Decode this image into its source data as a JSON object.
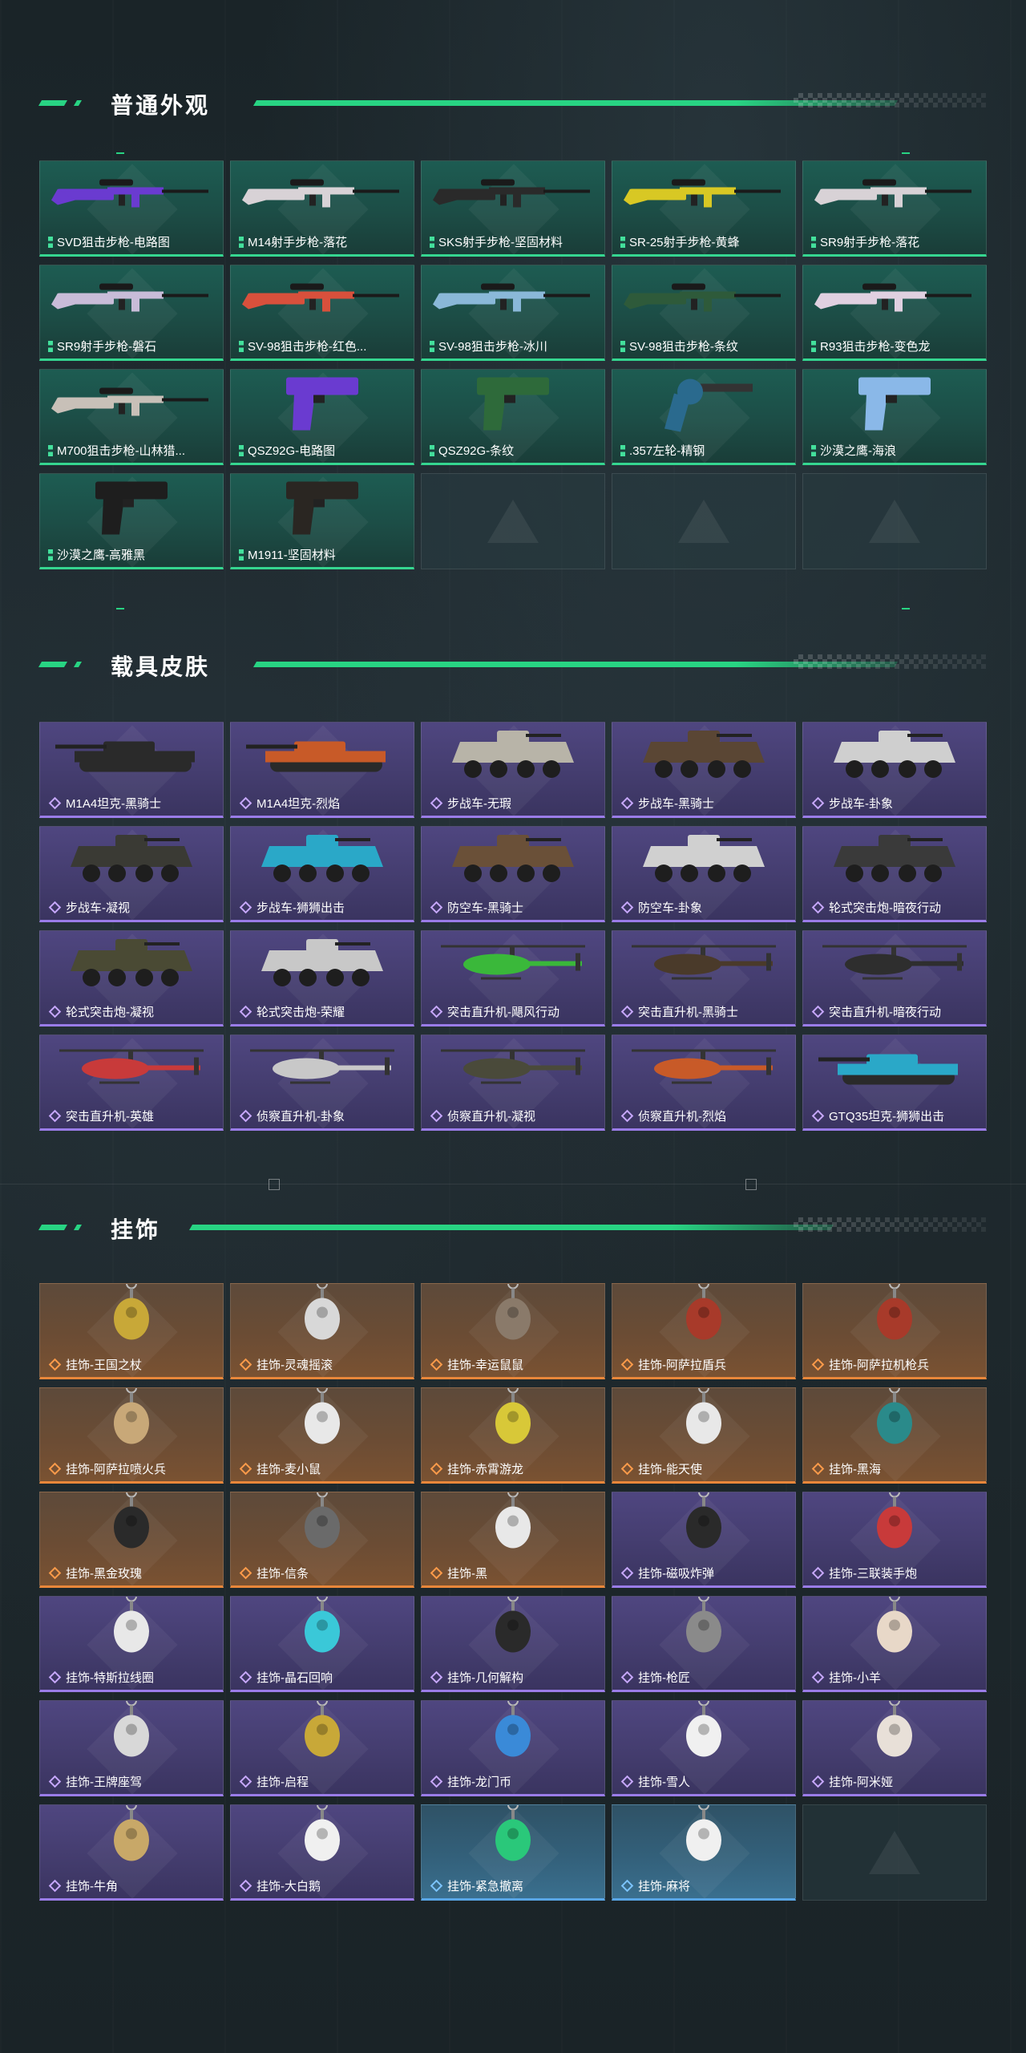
{
  "sections": [
    {
      "title": "普通外观",
      "items": [
        {
          "label": "SVD狙击步枪-电路图",
          "rarity": "green",
          "icon": "rifle-icon",
          "color": "#6a3bd0"
        },
        {
          "label": "M14射手步枪-落花",
          "rarity": "green",
          "icon": "rifle-icon",
          "color": "#d8d2d6"
        },
        {
          "label": "SKS射手步枪-坚固材料",
          "rarity": "green",
          "icon": "rifle-icon",
          "color": "#2a2a2a"
        },
        {
          "label": "SR-25射手步枪-黄蜂",
          "rarity": "green",
          "icon": "rifle-icon",
          "color": "#d8c824"
        },
        {
          "label": "SR9射手步枪-落花",
          "rarity": "green",
          "icon": "rifle-icon",
          "color": "#d8d2d6"
        },
        {
          "label": "SR9射手步枪-磐石",
          "rarity": "green",
          "icon": "rifle-icon",
          "color": "#c8bcd8"
        },
        {
          "label": "SV-98狙击步枪-红色...",
          "rarity": "green",
          "icon": "rifle-icon",
          "color": "#d8503c"
        },
        {
          "label": "SV-98狙击步枪-冰川",
          "rarity": "green",
          "icon": "rifle-icon",
          "color": "#8ab8d8"
        },
        {
          "label": "SV-98狙击步枪-条纹",
          "rarity": "green",
          "icon": "rifle-icon",
          "color": "#2e5a3a"
        },
        {
          "label": "R93狙击步枪-变色龙",
          "rarity": "green",
          "icon": "rifle-icon",
          "color": "#e0d0e0"
        },
        {
          "label": "M700狙击步枪-山林猎...",
          "rarity": "green",
          "icon": "rifle-icon",
          "color": "#c8c0b8"
        },
        {
          "label": "QSZ92G-电路图",
          "rarity": "green",
          "icon": "pistol-icon",
          "color": "#6a3bd0"
        },
        {
          "label": "QSZ92G-条纹",
          "rarity": "green",
          "icon": "pistol-icon",
          "color": "#2e6a3a"
        },
        {
          "label": ".357左轮-精钢",
          "rarity": "green",
          "icon": "revolver-icon",
          "color": "#2a6a8e"
        },
        {
          "label": "沙漠之鹰-海浪",
          "rarity": "green",
          "icon": "pistol-icon",
          "color": "#8ab8e8"
        },
        {
          "label": "沙漠之鹰-高雅黑",
          "rarity": "green",
          "icon": "pistol-icon",
          "color": "#1e1e1e"
        },
        {
          "label": "M1911-坚固材料",
          "rarity": "green",
          "icon": "pistol-icon",
          "color": "#2a2622"
        },
        {
          "label": "",
          "rarity": "empty"
        },
        {
          "label": "",
          "rarity": "empty"
        },
        {
          "label": "",
          "rarity": "empty"
        }
      ]
    },
    {
      "title": "载具皮肤",
      "items": [
        {
          "label": "M1A4坦克-黑骑士",
          "rarity": "purple",
          "icon": "tank-icon",
          "color": "#2a2a2a"
        },
        {
          "label": "M1A4坦克-烈焰",
          "rarity": "purple",
          "icon": "tank-icon",
          "color": "#c85a28"
        },
        {
          "label": "步战车-无瑕",
          "rarity": "purple",
          "icon": "armored-vehicle-icon",
          "color": "#b8b4a8"
        },
        {
          "label": "步战车-黑骑士",
          "rarity": "purple",
          "icon": "armored-vehicle-icon",
          "color": "#5a4634"
        },
        {
          "label": "步战车-卦象",
          "rarity": "purple",
          "icon": "armored-vehicle-icon",
          "color": "#cfcfcf"
        },
        {
          "label": "步战车-凝视",
          "rarity": "purple",
          "icon": "armored-vehicle-icon",
          "color": "#3a3a34"
        },
        {
          "label": "步战车-狮狮出击",
          "rarity": "purple",
          "icon": "armored-vehicle-icon",
          "color": "#2aa8c8"
        },
        {
          "label": "防空车-黑骑士",
          "rarity": "purple",
          "icon": "armored-vehicle-icon",
          "color": "#6a5038"
        },
        {
          "label": "防空车-卦象",
          "rarity": "purple",
          "icon": "armored-vehicle-icon",
          "color": "#d0d0d0"
        },
        {
          "label": "轮式突击炮-暗夜行动",
          "rarity": "purple",
          "icon": "armored-vehicle-icon",
          "color": "#3a3a3a"
        },
        {
          "label": "轮式突击炮-凝视",
          "rarity": "purple",
          "icon": "armored-vehicle-icon",
          "color": "#4a4a34"
        },
        {
          "label": "轮式突击炮-荣耀",
          "rarity": "purple",
          "icon": "armored-vehicle-icon",
          "color": "#c8c8c8"
        },
        {
          "label": "突击直升机-飓风行动",
          "rarity": "purple",
          "icon": "helicopter-icon",
          "color": "#3ab83a"
        },
        {
          "label": "突击直升机-黑骑士",
          "rarity": "purple",
          "icon": "helicopter-icon",
          "color": "#4a3a2a"
        },
        {
          "label": "突击直升机-暗夜行动",
          "rarity": "purple",
          "icon": "helicopter-icon",
          "color": "#2e2e2e"
        },
        {
          "label": "突击直升机-英雄",
          "rarity": "purple",
          "icon": "helicopter-icon",
          "color": "#c83a3a"
        },
        {
          "label": "侦察直升机-卦象",
          "rarity": "purple",
          "icon": "helicopter-icon",
          "color": "#c8c8c8"
        },
        {
          "label": "侦察直升机-凝视",
          "rarity": "purple",
          "icon": "helicopter-icon",
          "color": "#4a4a3a"
        },
        {
          "label": "侦察直升机-烈焰",
          "rarity": "purple",
          "icon": "helicopter-icon",
          "color": "#c85a28"
        },
        {
          "label": "GTQ35坦克-狮狮出击",
          "rarity": "purple",
          "icon": "tank-icon",
          "color": "#2aa8c8"
        }
      ]
    },
    {
      "title": "挂饰",
      "items": [
        {
          "label": "挂饰-王国之杖",
          "rarity": "orange",
          "icon": "charm-icon",
          "color": "#c8a838"
        },
        {
          "label": "挂饰-灵魂摇滚",
          "rarity": "orange",
          "icon": "charm-icon",
          "color": "#d8d8d8"
        },
        {
          "label": "挂饰-幸运鼠鼠",
          "rarity": "orange",
          "icon": "charm-icon",
          "color": "#8a7a6a"
        },
        {
          "label": "挂饰-阿萨拉盾兵",
          "rarity": "orange",
          "icon": "charm-icon",
          "color": "#a83a2a"
        },
        {
          "label": "挂饰-阿萨拉机枪兵",
          "rarity": "orange",
          "icon": "charm-icon",
          "color": "#a83a2a"
        },
        {
          "label": "挂饰-阿萨拉喷火兵",
          "rarity": "orange",
          "icon": "charm-icon",
          "color": "#c8a878"
        },
        {
          "label": "挂饰-麦小鼠",
          "rarity": "orange",
          "icon": "charm-icon",
          "color": "#e8e8e8"
        },
        {
          "label": "挂饰-赤霄游龙",
          "rarity": "orange",
          "icon": "charm-icon",
          "color": "#d8c838"
        },
        {
          "label": "挂饰-能天使",
          "rarity": "orange",
          "icon": "charm-icon",
          "color": "#e8e8e8"
        },
        {
          "label": "挂饰-黑海",
          "rarity": "orange",
          "icon": "charm-icon",
          "color": "#2a8a8a"
        },
        {
          "label": "挂饰-黑金玫瑰",
          "rarity": "orange",
          "icon": "charm-icon",
          "color": "#2a2a2a"
        },
        {
          "label": "挂饰-信条",
          "rarity": "orange",
          "icon": "charm-icon",
          "color": "#6a6a6a"
        },
        {
          "label": "挂饰-黑",
          "rarity": "orange",
          "icon": "charm-icon",
          "color": "#e8e8e8"
        },
        {
          "label": "挂饰-磁吸炸弹",
          "rarity": "purple",
          "icon": "charm-icon",
          "color": "#2a2a2a"
        },
        {
          "label": "挂饰-三联装手炮",
          "rarity": "purple",
          "icon": "charm-icon",
          "color": "#c83a3a"
        },
        {
          "label": "挂饰-特斯拉线圈",
          "rarity": "purple",
          "icon": "charm-icon",
          "color": "#e8e8e8"
        },
        {
          "label": "挂饰-晶石回响",
          "rarity": "purple",
          "icon": "charm-icon",
          "color": "#3ac8d8"
        },
        {
          "label": "挂饰-几何解构",
          "rarity": "purple",
          "icon": "charm-icon",
          "color": "#2a2a2a"
        },
        {
          "label": "挂饰-枪匠",
          "rarity": "purple",
          "icon": "charm-icon",
          "color": "#8a8a8a"
        },
        {
          "label": "挂饰-小羊",
          "rarity": "purple",
          "icon": "charm-icon",
          "color": "#e8d8c8"
        },
        {
          "label": "挂饰-王牌座驾",
          "rarity": "purple",
          "icon": "charm-icon",
          "color": "#d8d8d8"
        },
        {
          "label": "挂饰-启程",
          "rarity": "purple",
          "icon": "charm-icon",
          "color": "#c8a838"
        },
        {
          "label": "挂饰-龙门币",
          "rarity": "purple",
          "icon": "charm-icon",
          "color": "#3a8ad8"
        },
        {
          "label": "挂饰-雪人",
          "rarity": "purple",
          "icon": "charm-icon",
          "color": "#f0f0f0"
        },
        {
          "label": "挂饰-阿米娅",
          "rarity": "purple",
          "icon": "charm-icon",
          "color": "#e8e0d8"
        },
        {
          "label": "挂饰-牛角",
          "rarity": "purple",
          "icon": "charm-icon",
          "color": "#c8a868"
        },
        {
          "label": "挂饰-大白鹅",
          "rarity": "purple",
          "icon": "charm-icon",
          "color": "#f0f0f0"
        },
        {
          "label": "挂饰-紧急撤离",
          "rarity": "blue",
          "icon": "charm-icon",
          "color": "#2ac87a"
        },
        {
          "label": "挂饰-麻将",
          "rarity": "blue",
          "icon": "charm-icon",
          "color": "#f0f0f0"
        },
        {
          "label": "",
          "rarity": "empty"
        }
      ]
    }
  ]
}
